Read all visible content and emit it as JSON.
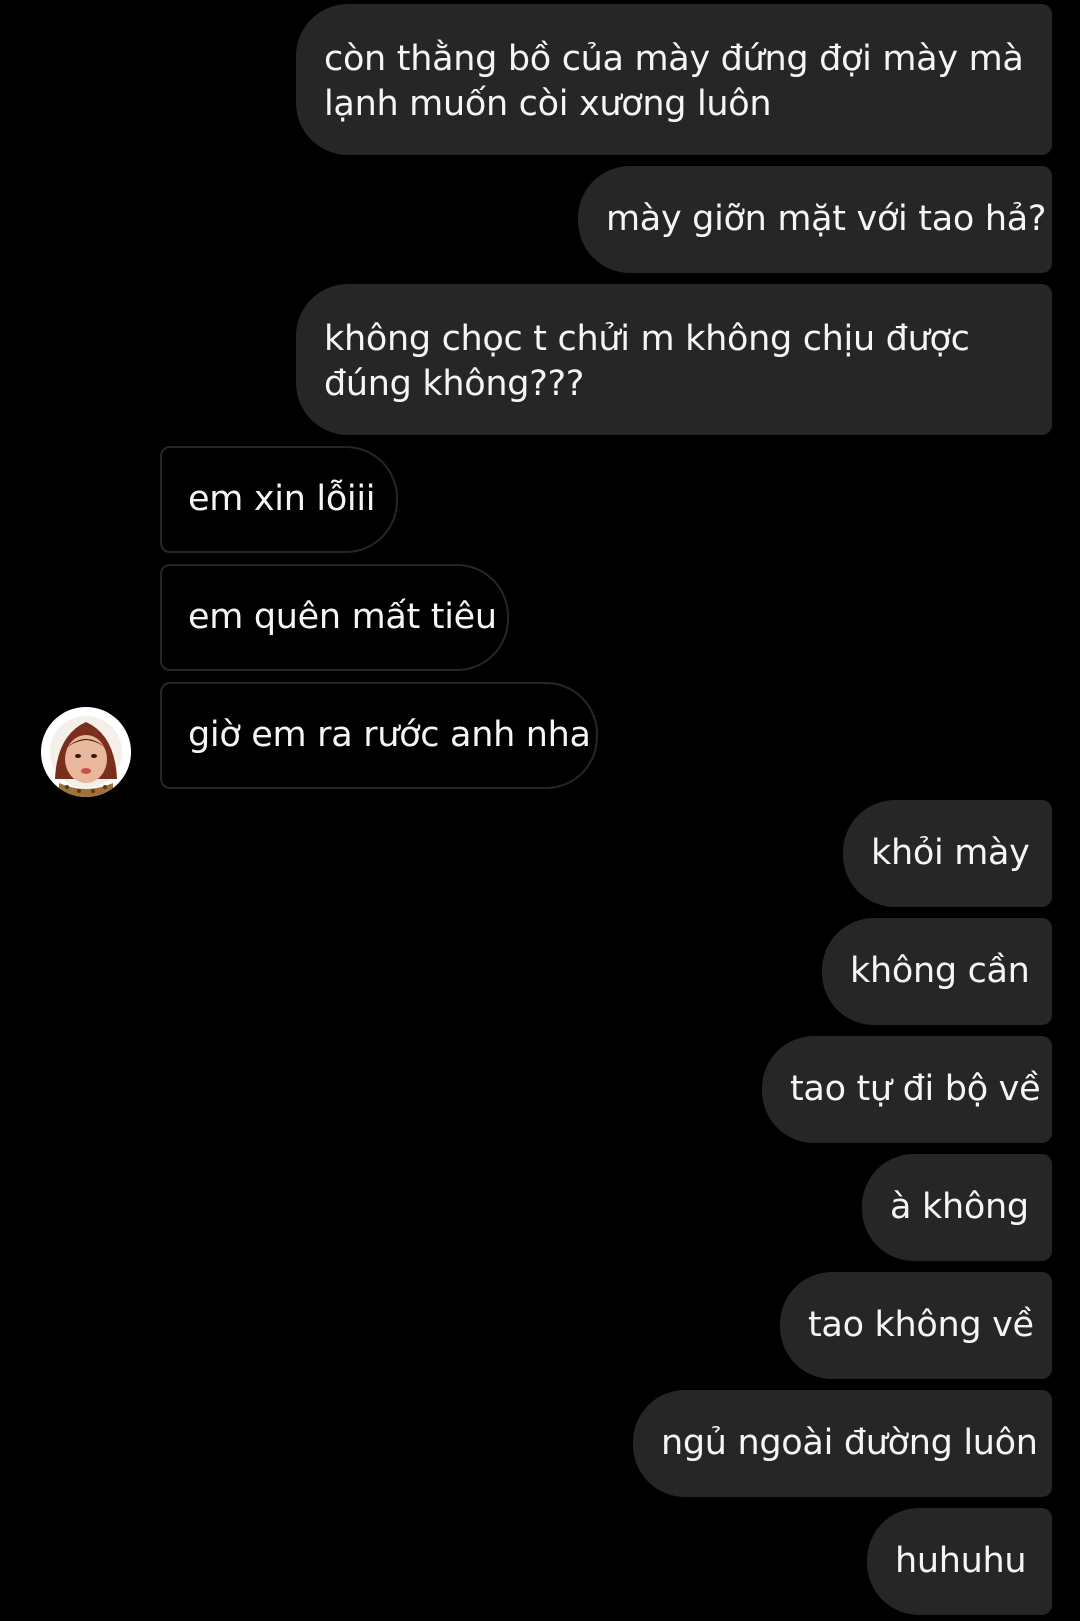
{
  "colors": {
    "background": "#000000",
    "sent_bubble": "#262626",
    "received_border": "#262626",
    "text": "#f5f5f5"
  },
  "messages": [
    {
      "direction": "sent",
      "lines": [
        "còn thằng bồ của mày đứng đợi mày mà",
        "lạnh muốn còi xương luôn"
      ]
    },
    {
      "direction": "sent",
      "lines": [
        "mày giỡn mặt với tao hả?"
      ]
    },
    {
      "direction": "sent",
      "lines": [
        "không chọc t chửi m không chịu được",
        "đúng không???"
      ]
    },
    {
      "direction": "received",
      "lines": [
        "em xin lỗiii"
      ]
    },
    {
      "direction": "received",
      "lines": [
        "em quên mất tiêu"
      ]
    },
    {
      "direction": "received",
      "lines": [
        "giờ em ra rước anh nha"
      ]
    },
    {
      "direction": "sent",
      "lines": [
        "khỏi mày"
      ]
    },
    {
      "direction": "sent",
      "lines": [
        "không cần"
      ]
    },
    {
      "direction": "sent",
      "lines": [
        "tao tự đi bộ về"
      ]
    },
    {
      "direction": "sent",
      "lines": [
        "à không"
      ]
    },
    {
      "direction": "sent",
      "lines": [
        "tao không về"
      ]
    },
    {
      "direction": "sent",
      "lines": [
        "ngủ ngoài đường luôn"
      ]
    },
    {
      "direction": "sent",
      "lines": [
        "huhuhu"
      ]
    }
  ],
  "avatar": {
    "icon": "profile-photo-avatar"
  }
}
